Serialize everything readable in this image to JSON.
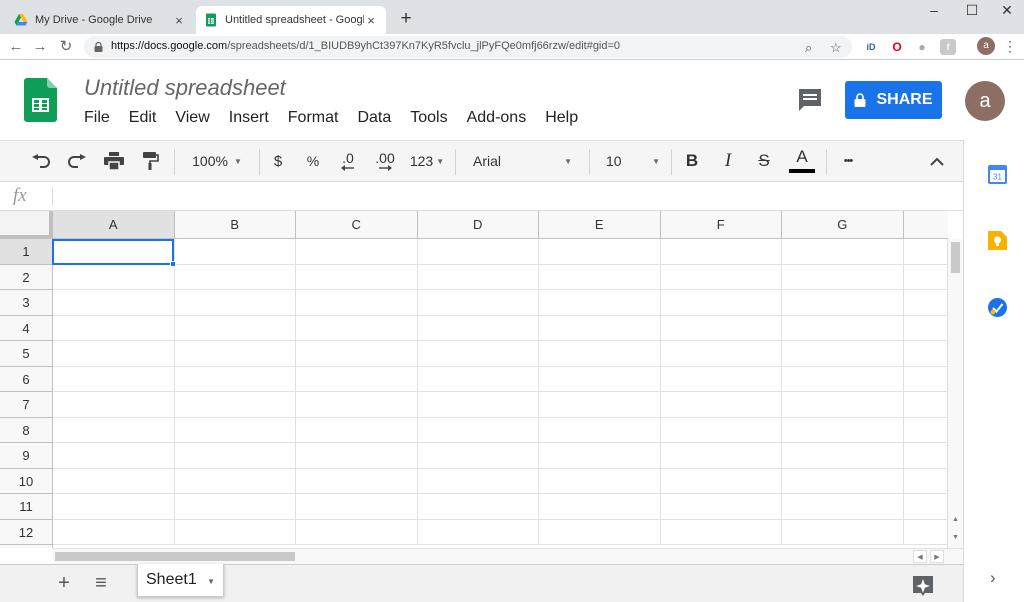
{
  "browser": {
    "tabs": [
      {
        "title": "My Drive - Google Drive",
        "active": false
      },
      {
        "title": "Untitled spreadsheet - Google Sl",
        "active": true
      }
    ],
    "new_tab": "+",
    "window_controls": {
      "minimize": "–",
      "maximize": "☐",
      "close": "✕"
    },
    "url_host": "https://docs.google.com",
    "url_path": "/spreadsheets/d/1_BIUDB9yhCt397Kn7KyR5fvclu_jlPyFQe0mfj66rzw/edit#gid=0",
    "extensions": {
      "id_label": "iD",
      "opera_label": "O"
    },
    "profile_initial": "a"
  },
  "doc": {
    "title": "Untitled spreadsheet",
    "menus": [
      "File",
      "Edit",
      "View",
      "Insert",
      "Format",
      "Data",
      "Tools",
      "Add-ons",
      "Help"
    ],
    "share_label": "SHARE",
    "avatar_initial": "a"
  },
  "toolbar": {
    "zoom": "100%",
    "currency": "$",
    "percent": "%",
    "decrease_decimal": ".0",
    "increase_decimal": ".00",
    "number_format": "123",
    "font": "Arial",
    "font_size": "10",
    "bold": "B",
    "italic": "I",
    "strikethrough": "S",
    "text_color_letter": "A",
    "more": "•••",
    "collapse": "⌃"
  },
  "formula_bar": {
    "fx": "fx",
    "value": ""
  },
  "grid": {
    "columns": [
      "A",
      "B",
      "C",
      "D",
      "E",
      "F",
      "G"
    ],
    "rows": [
      "1",
      "2",
      "3",
      "4",
      "5",
      "6",
      "7",
      "8",
      "9",
      "10",
      "11",
      "12"
    ],
    "active_cell": "A1"
  },
  "sheetbar": {
    "add_sheet": "+",
    "all_sheets": "≡",
    "sheets": [
      {
        "name": "Sheet1",
        "active": true
      }
    ]
  },
  "colors": {
    "accent": "#1a73e8",
    "sheets_green": "#0f9d58",
    "avatar_brown": "#8d6e63",
    "keep_yellow": "#f6b400",
    "calendar_blue": "#4285f4"
  },
  "side_panel": {
    "icons": [
      "calendar-icon",
      "keep-icon",
      "tasks-icon"
    ],
    "calendar_label": "31"
  }
}
